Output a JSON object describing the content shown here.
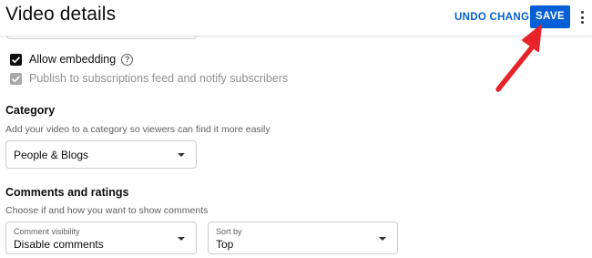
{
  "header": {
    "title": "Video details",
    "undo_label": "UNDO CHANGES",
    "save_label": "SAVE",
    "more_icon": "more-vert-icon"
  },
  "embedding": {
    "allow_label": "Allow embedding",
    "allow_checked": true,
    "publish_label": "Publish to subscriptions feed and notify subscribers",
    "publish_checked": true,
    "publish_disabled": true
  },
  "category": {
    "title": "Category",
    "description": "Add your video to a category so viewers can find it more easily",
    "selected": "People & Blogs"
  },
  "comments": {
    "title": "Comments and ratings",
    "description": "Choose if and how you want to show comments",
    "visibility_label": "Comment visibility",
    "visibility_value": "Disable comments",
    "sort_label": "Sort by",
    "sort_value": "Top"
  },
  "colors": {
    "accent": "#065fd4",
    "annotation_arrow": "#e8242b"
  }
}
